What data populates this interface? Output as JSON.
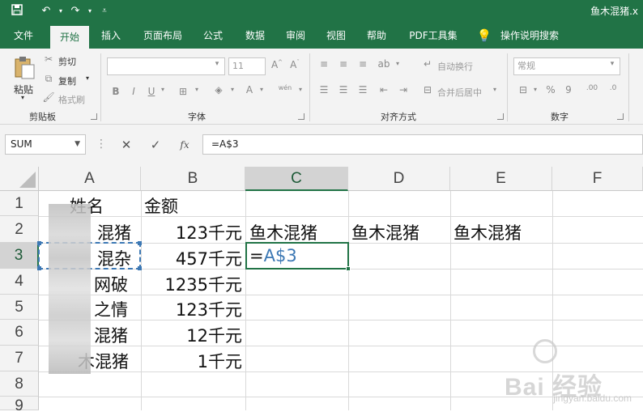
{
  "window": {
    "title": "鱼木混猪.x"
  },
  "quick_access": {
    "save_icon": "save-icon",
    "undo_icon": "undo-icon",
    "redo_icon": "redo-icon",
    "customize_icon": "customize-icon"
  },
  "tabs": [
    {
      "label": "文件"
    },
    {
      "label": "开始"
    },
    {
      "label": "插入"
    },
    {
      "label": "页面布局"
    },
    {
      "label": "公式"
    },
    {
      "label": "数据"
    },
    {
      "label": "审阅"
    },
    {
      "label": "视图"
    },
    {
      "label": "帮助"
    },
    {
      "label": "PDF工具集"
    },
    {
      "label": "操作说明搜索"
    }
  ],
  "ribbon": {
    "clipboard": {
      "paste": "粘贴",
      "cut": "剪切",
      "copy": "复制",
      "format_painter": "格式刷",
      "group": "剪贴板"
    },
    "font": {
      "size": "11",
      "bold": "B",
      "italic": "I",
      "underline": "U",
      "font_color": "A",
      "phonetic": "wén",
      "group": "字体"
    },
    "alignment": {
      "wrap_text": "自动换行",
      "merge_center": "合并后居中",
      "group": "对齐方式"
    },
    "number": {
      "format": "常规",
      "percent": "%",
      "comma": "9",
      "group": "数字"
    }
  },
  "formula_bar": {
    "name_box": "SUM",
    "formula": "=A$3",
    "cancel": "✕",
    "enter": "✓",
    "fx": "fx"
  },
  "columns": [
    "A",
    "B",
    "C",
    "D",
    "E",
    "F"
  ],
  "rows": [
    "1",
    "2",
    "3",
    "4",
    "5",
    "6",
    "7",
    "8",
    "9"
  ],
  "cells": {
    "A1": "姓名",
    "B1": "金额",
    "A2": "混猪",
    "B2": "123千元",
    "C2": "鱼木混猪",
    "D2": "鱼木混猪",
    "E2": "鱼木混猪",
    "A3": "混杂",
    "B3": "457千元",
    "C3_eq": "=",
    "C3_ref": "A$3",
    "A4": "网破",
    "B4": "1235千元",
    "A5": "之情",
    "B5": "123千元",
    "A6": "混猪",
    "B6": "12千元",
    "A7": "木混猪",
    "B7": "1千元"
  },
  "watermark": {
    "main": "Bai 经验",
    "sub": "jingyan.baidu.com"
  }
}
